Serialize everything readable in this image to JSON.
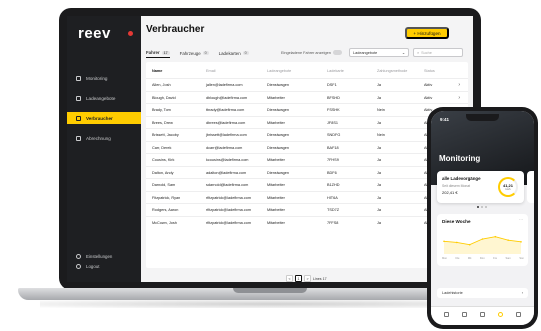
{
  "app": {
    "logo": "reev",
    "page_title": "Verbraucher",
    "add_button": "+ Hinzufügen"
  },
  "sidebar": {
    "items": [
      {
        "label": "Monitoring",
        "icon": "monitor-icon"
      },
      {
        "label": "Ladeangebote",
        "icon": "charging-icon"
      },
      {
        "label": "Verbraucher",
        "icon": "users-icon",
        "active": true
      },
      {
        "label": "Abrechnung",
        "icon": "invoice-icon"
      }
    ],
    "bottom": [
      {
        "label": "Einstellungen",
        "icon": "gear-icon"
      },
      {
        "label": "Logout",
        "icon": "logout-icon"
      }
    ]
  },
  "tabs": [
    {
      "label": "Fahrer",
      "count": "17",
      "active": true
    },
    {
      "label": "Fahrzeuge",
      "count": "0"
    },
    {
      "label": "Ladekarten",
      "count": "0"
    }
  ],
  "toolbar": {
    "toggle_label": "Eingeladene Fahrer anzeigen",
    "select_value": "Ladeangebote",
    "search_placeholder": "Suche"
  },
  "table": {
    "headers": [
      "Name",
      "Email",
      "Ladeangebote",
      "Ladekarte",
      "Zahlungsmethode",
      "Status"
    ],
    "rows": [
      [
        "Allen, Josh",
        "jallen@ladefirma.com",
        "Dienstwagen",
        "DSF1",
        "Ja",
        "Aktiv"
      ],
      [
        "Blough, David",
        "dblough@ladefirma.com",
        "Mitarbeiter",
        "BFSHD",
        "Ja",
        "Aktiv"
      ],
      [
        "Brady, Tom",
        "tbrady@ladefirma.com",
        "Dienstwagen",
        "FSSHK",
        "Nein",
        "Aktiv"
      ],
      [
        "Brees, Drew",
        "dbrees@ladefirma.com",
        "Mitarbeiter",
        "JF8S1",
        "Ja",
        "Aktiv"
      ],
      [
        "Brissett, Jacoby",
        "jbrissett@ladefirma.com",
        "Dienstwagen",
        "SNDFG",
        "Nein",
        "Aktiv"
      ],
      [
        "Carr, Derek",
        "dcarr@ladefirma.com",
        "Dienstwagen",
        "BAF18",
        "Ja",
        "Aktiv"
      ],
      [
        "Cousins, Kirk",
        "kcousins@ladefirma.com",
        "Mitarbeiter",
        "7FHS9",
        "Ja",
        "Aktiv"
      ],
      [
        "Dalton, Andy",
        "adalton@ladefirma.com",
        "Dienstwagen",
        "BDF6",
        "Ja",
        "Aktiv"
      ],
      [
        "Darnold, Sam",
        "sdarnold@ladefirma.com",
        "Mitarbeiter",
        "B1ZHD",
        "Ja",
        "Aktiv"
      ],
      [
        "Fitzpatrick, Ryan",
        "rfitzpatrick@ladefirma.com",
        "Mitarbeiter",
        "HIT6A",
        "Ja",
        "Aktiv"
      ],
      [
        "Rodgers, Aaron",
        "rfitzpatrick@ladefirma.com",
        "Mitarbeiter",
        "TSD7Z",
        "Ja",
        "Aktiv"
      ],
      [
        "McCown, Josh",
        "rfitzpatrick@ladefirma.com",
        "Mitarbeiter",
        "7FFS8",
        "Ja",
        "Aktiv"
      ]
    ]
  },
  "pager": {
    "prev": "<",
    "current": "1",
    "next": ">",
    "size": "Lines 17"
  },
  "phone": {
    "time": "9:41",
    "title": "Monitoring",
    "card1": {
      "label": "alle Ladevorgänge",
      "sub": "Seit diesem Monat",
      "amount": "202,41 €",
      "ring_value": "41,21",
      "ring_unit": "kwh"
    },
    "card2": {
      "title": "Diese Woche",
      "more": "···"
    },
    "days": [
      "Mon",
      "Die",
      "Mit",
      "Don",
      "Fre",
      "Sam",
      "Son"
    ],
    "week_values": [
      3.2,
      3.0,
      2.6,
      3.6,
      4.0,
      3.4,
      3.1
    ],
    "list_item": "Ladehistorie",
    "tabbar_icons": [
      "home-icon",
      "charging-icon",
      "card-icon",
      "clock-icon",
      "user-icon"
    ]
  },
  "colors": {
    "accent": "#ffcc00",
    "sidebar": "#1e1f22",
    "danger": "#e53935"
  }
}
